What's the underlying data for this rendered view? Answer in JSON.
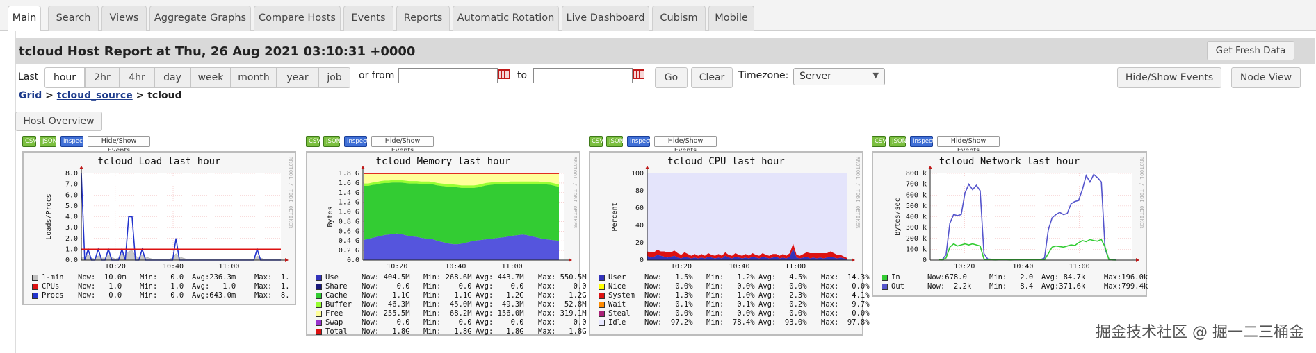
{
  "tabs": [
    {
      "label": "Main",
      "active": true
    },
    {
      "label": "Search"
    },
    {
      "label": "Views"
    },
    {
      "label": "Aggregate Graphs"
    },
    {
      "label": "Compare Hosts"
    },
    {
      "label": "Events"
    },
    {
      "label": "Reports"
    },
    {
      "label": "Automatic Rotation"
    },
    {
      "label": "Live Dashboard"
    },
    {
      "label": "Cubism"
    },
    {
      "label": "Mobile"
    }
  ],
  "header": {
    "title": "tcloud Host Report at Thu, 26 Aug 2021 03:10:31 +0000",
    "fresh_label": "Get Fresh Data"
  },
  "range": {
    "last_label": "Last",
    "options": [
      "hour",
      "2hr",
      "4hr",
      "day",
      "week",
      "month",
      "year",
      "job"
    ],
    "active": "hour",
    "or_from": "or from",
    "to": "to",
    "from_value": "",
    "to_value": "",
    "go": "Go",
    "clear": "Clear",
    "timezone_label": "Timezone:",
    "timezone_value": "Server",
    "hide_show_events": "Hide/Show Events",
    "node_view": "Node View"
  },
  "breadcrumb": {
    "grid": "Grid",
    "sep1": ">",
    "source": "tcloud_source",
    "sep2": ">",
    "host": "tcloud"
  },
  "host_overview": "Host Overview",
  "chip_labels": {
    "csv": "CSV",
    "json": "JSON",
    "inspect": "Inspect",
    "events": "Hide/Show Events"
  },
  "rrd_label": "RRDTOOL / TOBI OETIKER",
  "graphs": [
    {
      "title": "tcloud Load last hour",
      "ylabel": "Loads/Procs",
      "yticks": [
        "8.0",
        "7.0",
        "6.0",
        "5.0",
        "4.0",
        "3.0",
        "2.0",
        "1.0",
        "0.0"
      ],
      "xticks": [
        "10:20",
        "10:40",
        "11:00"
      ],
      "legend": [
        {
          "color": "#c0c0c0",
          "name": "1-min",
          "now": "Now:  10.0m",
          "min": "Min:   0.0",
          "avg": "Avg:236.3m",
          "max": "Max:  1."
        },
        {
          "color": "#dd1111",
          "name": "CPUs",
          "now": "Now:   1.0",
          "min": "Min:   1.0",
          "avg": "Avg:   1.0",
          "max": "Max:  1."
        },
        {
          "color": "#2233cc",
          "name": "Procs",
          "now": "Now:   0.0",
          "min": "Min:   0.0",
          "avg": "Avg:643.0m",
          "max": "Max:  8."
        }
      ]
    },
    {
      "title": "tcloud Memory last hour",
      "ylabel": "Bytes",
      "yticks": [
        "1.8 G",
        "1.6 G",
        "1.4 G",
        "1.2 G",
        "1.0 G",
        "0.8 G",
        "0.6 G",
        "0.4 G",
        "0.2 G",
        "0.0"
      ],
      "xticks": [
        "10:20",
        "10:40",
        "11:00"
      ],
      "legend": [
        {
          "color": "#3333bb",
          "name": "Use",
          "now": "Now: 404.5M",
          "min": "Min: 268.6M",
          "avg": "Avg: 443.7M",
          "max": "Max: 550.5M"
        },
        {
          "color": "#1a1a7a",
          "name": "Share",
          "now": "Now:    0.0",
          "min": "Min:    0.0",
          "avg": "Avg:    0.0",
          "max": "Max:    0.0"
        },
        {
          "color": "#33cc33",
          "name": "Cache",
          "now": "Now:   1.1G",
          "min": "Min:   1.1G",
          "avg": "Avg:   1.2G",
          "max": "Max:   1.2G"
        },
        {
          "color": "#99ff33",
          "name": "Buffer",
          "now": "Now:  46.3M",
          "min": "Min:  45.0M",
          "avg": "Avg:  49.3M",
          "max": "Max:  52.8M"
        },
        {
          "color": "#ffff99",
          "name": "Free",
          "now": "Now: 255.5M",
          "min": "Min:  68.2M",
          "avg": "Avg: 156.0M",
          "max": "Max: 319.1M"
        },
        {
          "color": "#9933cc",
          "name": "Swap",
          "now": "Now:    0.0",
          "min": "Min:    0.0",
          "avg": "Avg:    0.0",
          "max": "Max:    0.0"
        },
        {
          "color": "#dd1111",
          "name": "Total",
          "now": "Now:   1.8G",
          "min": "Min:   1.8G",
          "avg": "Avg:   1.8G",
          "max": "Max:   1.8G"
        }
      ]
    },
    {
      "title": "tcloud CPU last hour",
      "ylabel": "Percent",
      "yticks": [
        "100",
        "80",
        "60",
        "40",
        "20",
        "0"
      ],
      "xticks": [
        "10:20",
        "10:40",
        "11:00"
      ],
      "legend": [
        {
          "color": "#3333bb",
          "name": "User",
          "now": "Now:   1.5%",
          "min": "Min:   1.2%",
          "avg": "Avg:   4.5%",
          "max": "Max:  14.3%"
        },
        {
          "color": "#ffff00",
          "name": "Nice",
          "now": "Now:   0.0%",
          "min": "Min:   0.0%",
          "avg": "Avg:   0.0%",
          "max": "Max:   0.0%"
        },
        {
          "color": "#dd1111",
          "name": "System",
          "now": "Now:   1.3%",
          "min": "Min:   1.0%",
          "avg": "Avg:   2.3%",
          "max": "Max:   4.1%"
        },
        {
          "color": "#ff8a00",
          "name": "Wait",
          "now": "Now:   0.1%",
          "min": "Min:   0.1%",
          "avg": "Avg:   0.2%",
          "max": "Max:   9.7%"
        },
        {
          "color": "#aa2277",
          "name": "Steal",
          "now": "Now:   0.0%",
          "min": "Min:   0.0%",
          "avg": "Avg:   0.0%",
          "max": "Max:   0.0%"
        },
        {
          "color": "#e8e8ff",
          "name": "Idle",
          "now": "Now:  97.2%",
          "min": "Min:  78.4%",
          "avg": "Avg:  93.0%",
          "max": "Max:  97.8%"
        }
      ]
    },
    {
      "title": "tcloud Network last hour",
      "ylabel": "Bytes/sec",
      "yticks": [
        "800 k",
        "700 k",
        "600 k",
        "500 k",
        "400 k",
        "300 k",
        "200 k",
        "100 k",
        "0"
      ],
      "xticks": [
        "10:20",
        "10:40",
        "11:00"
      ],
      "legend": [
        {
          "color": "#33cc33",
          "name": "In",
          "now": "Now:678.0",
          "min": "Min:   2.0",
          "avg": "Avg: 84.7k",
          "max": "Max:196.0k"
        },
        {
          "color": "#5555cc",
          "name": "Out",
          "now": "Now:  2.2k",
          "min": "Min:   8.4",
          "avg": "Avg:371.6k",
          "max": "Max:799.4k"
        }
      ]
    }
  ],
  "chart_data": [
    {
      "type": "line",
      "title": "tcloud Load last hour",
      "ylabel": "Loads/Procs",
      "ylim": [
        0,
        8
      ],
      "x_ticks": [
        "10:20",
        "10:40",
        "11:00"
      ],
      "series": [
        {
          "name": "CPUs",
          "values": [
            1.0,
            1.0,
            1.0,
            1.0,
            1.0,
            1.0,
            1.0,
            1.0,
            1.0,
            1.0,
            1.0,
            1.0,
            1.0,
            1.0,
            1.0,
            1.0,
            1.0,
            1.0,
            1.0,
            1.0,
            1.0,
            1.0,
            1.0,
            1.0,
            1.0,
            1.0,
            1.0,
            1.0,
            1.0,
            1.0,
            1.0,
            1.0,
            1.0,
            1.0,
            1.0,
            1.0,
            1.0,
            1.0,
            1.0,
            1.0,
            1.0,
            1.0,
            1.0,
            1.0,
            1.0,
            1.0,
            1.0,
            1.0,
            1.0,
            1.0,
            1.0,
            1.0,
            1.0,
            1.0,
            1.0,
            1.0,
            1.0,
            1.0,
            1.0,
            1.0
          ]
        },
        {
          "name": "Procs",
          "values": [
            8.0,
            0,
            1.0,
            0,
            0,
            1.0,
            0,
            0,
            1.0,
            0,
            0,
            0,
            1.0,
            0,
            4.0,
            4.0,
            0,
            0,
            1.0,
            0,
            0,
            0,
            0,
            0,
            0,
            0,
            0,
            0,
            2.0,
            0,
            0,
            0,
            0,
            0,
            0,
            0,
            0,
            0,
            0,
            0,
            0,
            0,
            0,
            0,
            0,
            0,
            0,
            0,
            0,
            0,
            0,
            0,
            1.0,
            0,
            0,
            0,
            0,
            0,
            0,
            0
          ]
        },
        {
          "name": "1-min",
          "values": [
            0.3,
            0.2,
            0.5,
            0.2,
            0.1,
            0.4,
            0.2,
            0.2,
            0.5,
            0.3,
            0.1,
            0.2,
            0.6,
            0.4,
            0.8,
            0.9,
            0.4,
            0.2,
            0.5,
            0.3,
            0.2,
            0.1,
            0.1,
            0.1,
            0.1,
            0.1,
            0.1,
            0.2,
            0.6,
            0.3,
            0.2,
            0.1,
            0.1,
            0.1,
            0.1,
            0.1,
            0.1,
            0.1,
            0.1,
            0.1,
            0.1,
            0.1,
            0.1,
            0.1,
            0.1,
            0.1,
            0.1,
            0.1,
            0.1,
            0.1,
            0.1,
            0.1,
            0.4,
            0.2,
            0.1,
            0.1,
            0.1,
            0.1,
            0.1,
            0.1
          ]
        }
      ]
    },
    {
      "type": "area",
      "title": "tcloud Memory last hour",
      "ylabel": "Bytes",
      "ylim": [
        0,
        1.8
      ],
      "x_ticks": [
        "10:20",
        "10:40",
        "11:00"
      ],
      "series": [
        {
          "name": "Use",
          "values": [
            0.42,
            0.44,
            0.46,
            0.48,
            0.5,
            0.52,
            0.53,
            0.54,
            0.55,
            0.54,
            0.52,
            0.5,
            0.49,
            0.48,
            0.46,
            0.45,
            0.44,
            0.43,
            0.4,
            0.38,
            0.36,
            0.34,
            0.33,
            0.33,
            0.34,
            0.36,
            0.38,
            0.4,
            0.41,
            0.42,
            0.43,
            0.44,
            0.45,
            0.46,
            0.47,
            0.48,
            0.5,
            0.51,
            0.52,
            0.53,
            0.52,
            0.5,
            0.48,
            0.46,
            0.44,
            0.43,
            0.42,
            0.41,
            0.4
          ]
        },
        {
          "name": "Cache",
          "values": [
            1.12,
            1.1,
            1.1,
            1.09,
            1.09,
            1.08,
            1.07,
            1.07,
            1.06,
            1.07,
            1.08,
            1.09,
            1.1,
            1.11,
            1.12,
            1.13,
            1.14,
            1.14,
            1.15,
            1.16,
            1.17,
            1.18,
            1.19,
            1.18,
            1.16,
            1.14,
            1.12,
            1.1,
            1.1,
            1.11,
            1.12,
            1.12,
            1.12,
            1.11,
            1.1,
            1.09,
            1.08,
            1.07,
            1.06,
            1.05,
            1.06,
            1.08,
            1.1,
            1.12,
            1.13,
            1.14,
            1.14,
            1.13,
            1.12
          ]
        },
        {
          "name": "Buffer",
          "values": [
            0.05,
            0.05,
            0.05,
            0.05,
            0.05,
            0.05,
            0.05,
            0.05,
            0.05,
            0.05,
            0.05,
            0.05,
            0.05,
            0.05,
            0.05,
            0.05,
            0.05,
            0.05,
            0.05,
            0.05,
            0.05,
            0.05,
            0.05,
            0.05,
            0.05,
            0.05,
            0.05,
            0.05,
            0.05,
            0.05,
            0.05,
            0.05,
            0.05,
            0.05,
            0.05,
            0.05,
            0.05,
            0.05,
            0.05,
            0.05,
            0.05,
            0.05,
            0.05,
            0.05,
            0.05,
            0.05,
            0.05,
            0.05,
            0.05
          ]
        },
        {
          "name": "Total",
          "values": [
            1.8
          ]
        }
      ]
    },
    {
      "type": "area",
      "title": "tcloud CPU last hour",
      "ylabel": "Percent",
      "ylim": [
        0,
        100
      ],
      "x_ticks": [
        "10:20",
        "10:40",
        "11:00"
      ],
      "series": [
        {
          "name": "User",
          "values": [
            5,
            3,
            4,
            6,
            5,
            4,
            3,
            4,
            5,
            3,
            2,
            4,
            3,
            2,
            3,
            2,
            3,
            2,
            4,
            3,
            2,
            3,
            2,
            5,
            3,
            2,
            4,
            3,
            2,
            3,
            2,
            4,
            3,
            2,
            4,
            3,
            2,
            3,
            4,
            2,
            3,
            2,
            4,
            13,
            3,
            2,
            3,
            4,
            2,
            3,
            2,
            3,
            2,
            3,
            4,
            3,
            2,
            3,
            2,
            1
          ]
        },
        {
          "name": "System",
          "values": [
            5,
            6,
            5,
            6,
            5,
            6,
            6,
            5,
            6,
            5,
            4,
            5,
            4,
            3,
            4,
            3,
            4,
            3,
            4,
            3,
            3,
            4,
            3,
            4,
            3,
            3,
            4,
            3,
            3,
            4,
            3,
            4,
            3,
            3,
            4,
            3,
            3,
            4,
            3,
            3,
            4,
            3,
            4,
            6,
            3,
            3,
            4,
            5,
            6,
            5,
            6,
            5,
            6,
            5,
            6,
            5,
            4,
            3,
            2,
            1.3
          ]
        },
        {
          "name": "Idle",
          "values": [
            90,
            91,
            91,
            88,
            90,
            90,
            91,
            91,
            89,
            92,
            94,
            91,
            93,
            95,
            93,
            95,
            93,
            95,
            92,
            94,
            95,
            93,
            95,
            91,
            94,
            95,
            92,
            94,
            95,
            93,
            95,
            92,
            94,
            95,
            92,
            94,
            95,
            93,
            93,
            95,
            93,
            95,
            92,
            81,
            94,
            95,
            93,
            91,
            92,
            92,
            92,
            92,
            92,
            92,
            90,
            92,
            94,
            94,
            96,
            97
          ]
        }
      ]
    },
    {
      "type": "line",
      "title": "tcloud Network last hour",
      "ylabel": "Bytes/sec",
      "ylim": [
        0,
        800000
      ],
      "x_ticks": [
        "10:20",
        "10:40",
        "11:00"
      ],
      "series": [
        {
          "name": "In",
          "values": [
            2000,
            1000,
            20000,
            120000,
            150000,
            130000,
            140000,
            150000,
            140000,
            150000,
            140000,
            130000,
            10000,
            2000,
            2000,
            1000,
            2000,
            2000,
            2000,
            1000,
            2000,
            2000,
            2000,
            2000,
            2000,
            2000,
            2000,
            2000,
            2000,
            60000,
            120000,
            130000,
            125000,
            120000,
            130000,
            140000,
            135000,
            160000,
            180000,
            170000,
            190000,
            180000,
            175000,
            190000,
            120000,
            5000,
            1000,
            700
          ]
        },
        {
          "name": "Out",
          "values": [
            8000,
            5000,
            50000,
            340000,
            420000,
            410000,
            420000,
            620000,
            700000,
            650000,
            690000,
            640000,
            60000,
            10000,
            8000,
            5000,
            8000,
            5000,
            8000,
            5000,
            8000,
            5000,
            8000,
            5000,
            8000,
            5000,
            8000,
            5000,
            20000,
            280000,
            390000,
            420000,
            440000,
            420000,
            430000,
            520000,
            540000,
            550000,
            650000,
            780000,
            720000,
            790000,
            760000,
            720000,
            100000,
            10000,
            3000,
            2200
          ]
        }
      ]
    }
  ],
  "watermark": "掘金技术社区 @ 掘一二三桶金"
}
